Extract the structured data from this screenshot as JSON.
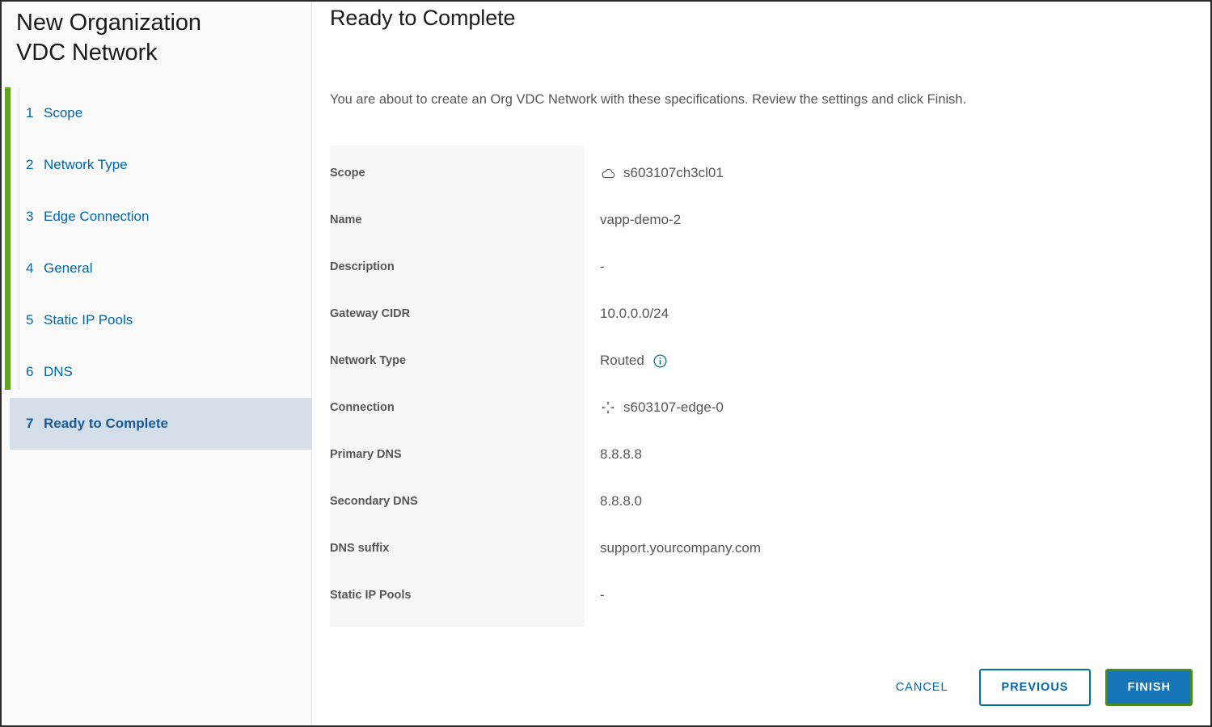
{
  "wizard": {
    "title": "New Organization\nVDC Network",
    "steps": [
      {
        "num": "1",
        "label": "Scope"
      },
      {
        "num": "2",
        "label": "Network Type"
      },
      {
        "num": "3",
        "label": "Edge Connection"
      },
      {
        "num": "4",
        "label": "General"
      },
      {
        "num": "5",
        "label": "Static IP Pools"
      },
      {
        "num": "6",
        "label": "DNS"
      },
      {
        "num": "7",
        "label": "Ready to Complete"
      }
    ],
    "active_step_index": 6,
    "progress_color": "#62a420"
  },
  "main": {
    "page_title": "Ready to Complete",
    "intro": "You are about to create an Org VDC Network with these specifications. Review the settings and click Finish.",
    "summary": [
      {
        "label": "Scope",
        "value": "s603107ch3cl01",
        "leading_icon": "cloud-icon"
      },
      {
        "label": "Name",
        "value": "vapp-demo-2"
      },
      {
        "label": "Description",
        "value": "-"
      },
      {
        "label": "Gateway CIDR",
        "value": "10.0.0.0/24"
      },
      {
        "label": "Network Type",
        "value": "Routed",
        "trailing_icon": "info-icon"
      },
      {
        "label": "Connection",
        "value": "s603107-edge-0",
        "leading_icon": "connect-arrows-icon"
      },
      {
        "label": "Primary DNS",
        "value": "8.8.8.8"
      },
      {
        "label": "Secondary DNS",
        "value": "8.8.8.0"
      },
      {
        "label": "DNS suffix",
        "value": "support.yourcompany.com"
      },
      {
        "label": "Static IP Pools",
        "value": "-"
      }
    ]
  },
  "footer": {
    "cancel_label": "CANCEL",
    "previous_label": "PREVIOUS",
    "finish_label": "FINISH",
    "accent_color": "#0065ab",
    "finish_bg": "#1676b7",
    "finish_outline": "#4b8b1e"
  }
}
